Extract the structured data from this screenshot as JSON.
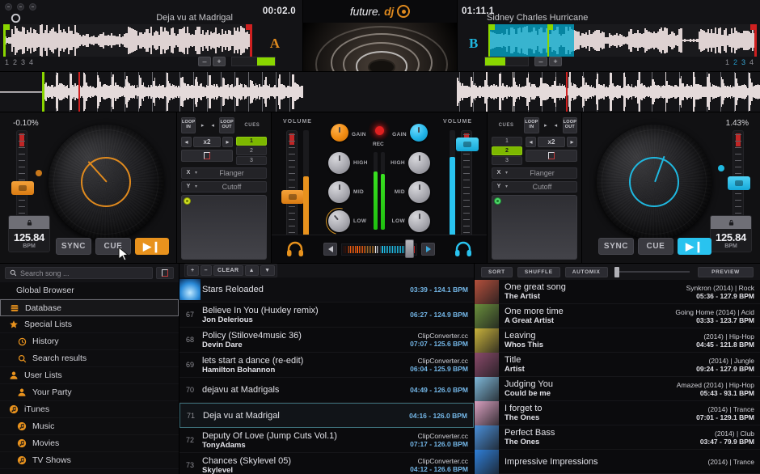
{
  "app": {
    "logo_text": "future.",
    "logo_accent": "dj",
    "logo_icon": "vinyl-icon"
  },
  "decks": {
    "a": {
      "letter": "A",
      "track_title": "Deja vu at Madrigal",
      "time": "00:02.0",
      "pitch_percent": "-0.10%",
      "bpm": "125.84",
      "bpm_unit": "BPM",
      "sync_label": "SYNC",
      "cue_label": "CUE",
      "play_label": "▶❙",
      "cue_numbers": [
        "1",
        "2",
        "3",
        "4"
      ],
      "zoom_minus": "–",
      "zoom_plus": "+"
    },
    "b": {
      "letter": "B",
      "track_title": "Sidney Charles Hurricane",
      "time": "01:11.1",
      "pitch_percent": "1.43%",
      "bpm": "125.84",
      "bpm_unit": "BPM",
      "sync_label": "SYNC",
      "cue_label": "CUE",
      "play_label": "▶❙",
      "cue_numbers": [
        "1",
        "2",
        "3",
        "4"
      ],
      "zoom_minus": "–",
      "zoom_plus": "+"
    }
  },
  "fx": {
    "loop_in": "LOOP IN",
    "loop_out": "LOOP OUT",
    "cues_label": "CUES",
    "loop_halve": "◂",
    "loop_size": "x2",
    "loop_double": "▸",
    "cue_slots_a": [
      "1",
      "2",
      "3"
    ],
    "cue_slots_b": [
      "1",
      "2",
      "3"
    ],
    "active_cue_a": "1",
    "active_cue_b": "2",
    "x_axis": "X",
    "y_axis": "Y",
    "x_effect": "Flanger",
    "y_effect": "Cutoff",
    "caret": "▾"
  },
  "mixer": {
    "volume_label": "VOLUME",
    "gain_label": "GAIN",
    "high_label": "HIGH",
    "mid_label": "MID",
    "low_label": "LOW",
    "rec_label": "REC",
    "headphone_icon": "headphone-icon",
    "xfade_left_icon": "triangle-left-icon",
    "xfade_right_icon": "triangle-right-icon"
  },
  "browser": {
    "search_placeholder": "Search song ...",
    "search_value": "",
    "search_icon": "search-icon",
    "clear_icon": "clear-icon",
    "sidebar": [
      {
        "label": "Global Browser",
        "icon": "",
        "level": 0,
        "selected": false
      },
      {
        "label": "Database",
        "icon": "database-icon",
        "level": 1,
        "selected": true
      },
      {
        "label": "Special Lists",
        "icon": "star-icon",
        "level": 1,
        "selected": false
      },
      {
        "label": "History",
        "icon": "history-icon",
        "level": 2,
        "selected": false
      },
      {
        "label": "Search results",
        "icon": "search-icon",
        "level": 2,
        "selected": false
      },
      {
        "label": "User Lists",
        "icon": "user-icon",
        "level": 1,
        "selected": false
      },
      {
        "label": "Your Party",
        "icon": "user-icon",
        "level": 2,
        "selected": false
      },
      {
        "label": "iTunes",
        "icon": "music-note-icon",
        "level": 1,
        "selected": false
      },
      {
        "label": "Music",
        "icon": "music-note-icon",
        "level": 2,
        "selected": false
      },
      {
        "label": "Movies",
        "icon": "music-note-icon",
        "level": 2,
        "selected": false
      },
      {
        "label": "TV Shows",
        "icon": "music-note-icon",
        "level": 2,
        "selected": false
      }
    ]
  },
  "tracklist": {
    "controls": {
      "add": "+",
      "remove": "–",
      "clear": "CLEAR",
      "up": "▲",
      "down": "▼"
    },
    "rows": [
      {
        "num": "",
        "title": "Stars Reloaded",
        "artist": "",
        "source": "",
        "duration": "03:39 - 124.1 BPM",
        "selected": false,
        "playing": true
      },
      {
        "num": "67",
        "title": "Believe In You (Huxley remix)",
        "artist": "Jon Delerious",
        "source": "",
        "duration": "06:27 - 124.9 BPM",
        "selected": false,
        "playing": false
      },
      {
        "num": "68",
        "title": "Policy (Stilove4music 36)",
        "artist": "Devin Dare",
        "source": "ClipConverter.cc",
        "duration": "07:07 - 125.6 BPM",
        "selected": false,
        "playing": false
      },
      {
        "num": "69",
        "title": "lets start a dance (re-edit)",
        "artist": "Hamilton Bohannon",
        "source": "ClipConverter.cc",
        "duration": "06:04 - 125.9 BPM",
        "selected": false,
        "playing": false
      },
      {
        "num": "70",
        "title": "dejavu at Madrigals",
        "artist": "",
        "source": "",
        "duration": "04:49 - 126.0 BPM",
        "selected": false,
        "playing": false
      },
      {
        "num": "71",
        "title": "Deja vu at Madrigal",
        "artist": "",
        "source": "",
        "duration": "04:16 - 126.0 BPM",
        "selected": true,
        "playing": false
      },
      {
        "num": "72",
        "title": "Deputy Of Love (Jump Cuts Vol.1)",
        "artist": "TonyAdams",
        "source": "ClipConverter.cc",
        "duration": "07:17 - 126.0 BPM",
        "selected": false,
        "playing": false
      },
      {
        "num": "73",
        "title": "Chances (Skylevel 05)",
        "artist": "Skylevel",
        "source": "ClipConverter.cc",
        "duration": "04:12 - 126.6 BPM",
        "selected": false,
        "playing": false
      }
    ]
  },
  "sidelist": {
    "controls": {
      "sort": "SORT",
      "shuffle": "SHUFFLE",
      "automix": "AUTOMIX",
      "preview": "PREVIEW"
    },
    "rows": [
      {
        "title": "One great song",
        "artist": "The Artist",
        "source": "Synkron (2014) | Rock",
        "duration": "05:36 - 127.9 BPM",
        "art": "#b4503c"
      },
      {
        "title": "One more time",
        "artist": "A Great Artist",
        "source": "Going Home (2014) | Acid",
        "duration": "03:33 - 123.7 BPM",
        "art": "#6a8f3c"
      },
      {
        "title": "Leaving",
        "artist": "Whos This",
        "source": "(2014) | Hip-Hop",
        "duration": "04:45 - 121.8 BPM",
        "art": "#c8b23c"
      },
      {
        "title": "Title",
        "artist": "Artist",
        "source": "(2014) | Jungle",
        "duration": "09:24 - 127.9 BPM",
        "art": "#8a4a6a"
      },
      {
        "title": "Judging You",
        "artist": "Could be me",
        "source": "Amazed (2014) | Hip-Hop",
        "duration": "05:43 - 93.1 BPM",
        "art": "#7fb8d8"
      },
      {
        "title": "I forget to",
        "artist": "The Ones",
        "source": "(2014) | Trance",
        "duration": "07:01 - 129.1 BPM",
        "art": "#d8a0c0"
      },
      {
        "title": "Perfect Bass",
        "artist": "The Ones",
        "source": "(2014) | Club",
        "duration": "03:47 - 79.9 BPM",
        "art": "#4a8fd8"
      },
      {
        "title": "Impressive Impressions",
        "artist": "",
        "source": "(2014) | Trance",
        "duration": "",
        "art": "#2f7fd8"
      }
    ]
  },
  "colors": {
    "deck_a": "#e08a1e",
    "deck_b": "#1fb8e0",
    "accent_green": "#8ad600",
    "rec_red": "#e02020",
    "bpm_blue": "#74b7e8"
  }
}
